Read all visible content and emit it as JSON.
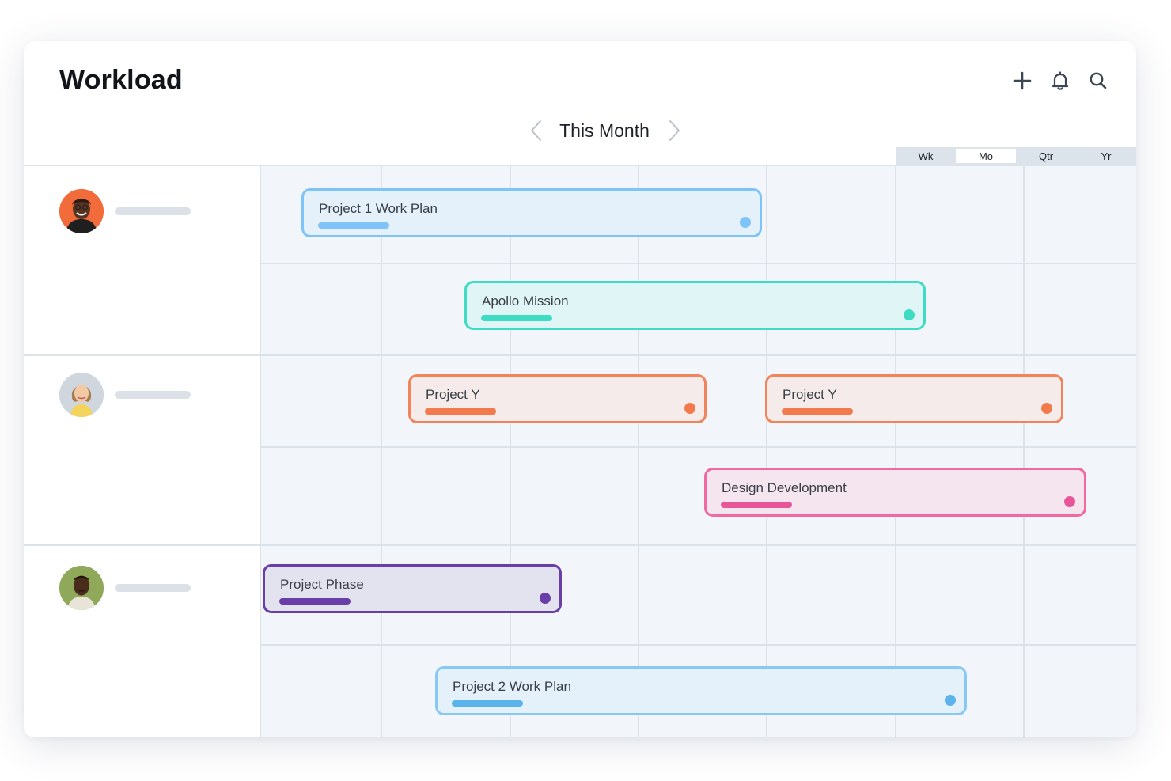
{
  "header": {
    "title": "Workload",
    "actions": [
      {
        "name": "add-icon",
        "icon": "plus"
      },
      {
        "name": "bell-icon",
        "icon": "bell"
      },
      {
        "name": "search-icon",
        "icon": "magnifier"
      }
    ]
  },
  "period": {
    "label": "This Month",
    "prev_icon": "chevron-left",
    "next_icon": "chevron-right"
  },
  "scale": {
    "options": [
      "Wk",
      "Mo",
      "Qtr",
      "Yr"
    ],
    "selected": "Mo"
  },
  "people": [
    {
      "avatar_bg": "#f26b3a",
      "name": ""
    },
    {
      "avatar_bg": "#cfd6dd",
      "name": ""
    },
    {
      "avatar_bg": "#8fa85a",
      "name": ""
    }
  ],
  "tasks": [
    {
      "label": "Project 1 Work Plan",
      "border": "#7ec4f8",
      "fill": "#e4f1fb",
      "bar": "#7ec4f8",
      "dot": "#7ec4f8"
    },
    {
      "label": "Apollo Mission",
      "border": "#3fdcc4",
      "fill": "#e0f5f5",
      "bar": "#3fdcc4",
      "dot": "#3fdcc4"
    },
    {
      "label": "Project Y",
      "border": "#f2845a",
      "fill": "#f4ebea",
      "bar": "#f37a4d",
      "dot": "#f37a4d"
    },
    {
      "label": "Project Y",
      "border": "#f2845a",
      "fill": "#f4ebea",
      "bar": "#f37a4d",
      "dot": "#f37a4d"
    },
    {
      "label": "Design Development",
      "border": "#ef6aa3",
      "fill": "#f5e5ee",
      "bar": "#e8569a",
      "dot": "#e8569a"
    },
    {
      "label": "Project Phase",
      "border": "#6a3ea8",
      "fill": "#e3e3ef",
      "bar": "#6a3ea8",
      "dot": "#6a3ea8"
    },
    {
      "label": "Project 2 Work Plan",
      "border": "#88c8f5",
      "fill": "#e4f1fb",
      "bar": "#5ab3ea",
      "dot": "#5ab3ea"
    }
  ]
}
